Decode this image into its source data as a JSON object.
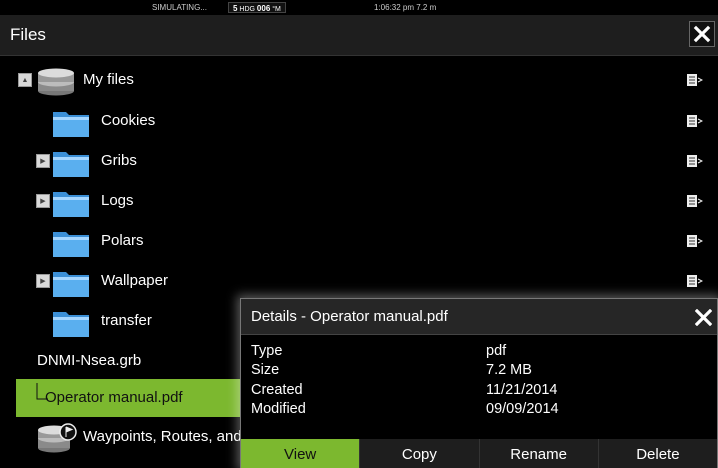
{
  "status": {
    "simulating": "SIMULATING...",
    "heading_value": "5",
    "heading_prefix": "HDG",
    "heading_degrees": "006",
    "heading_unit": "°M",
    "time_depth": "1:06:32 pm  7.2 m"
  },
  "window": {
    "title": "Files"
  },
  "tree": {
    "items": [
      {
        "label": "My files",
        "icon": "storage-drive-icon",
        "expander": "collapse"
      },
      {
        "label": "Cookies",
        "icon": "folder-icon",
        "expander": ""
      },
      {
        "label": "Gribs",
        "icon": "folder-icon",
        "expander": "expand"
      },
      {
        "label": "Logs",
        "icon": "folder-icon",
        "expander": "expand"
      },
      {
        "label": "Polars",
        "icon": "folder-icon",
        "expander": ""
      },
      {
        "label": "Wallpaper",
        "icon": "folder-icon",
        "expander": "expand"
      },
      {
        "label": "transfer",
        "icon": "folder-icon",
        "expander": ""
      },
      {
        "label": "DNMI-Nsea.grb",
        "icon": "",
        "expander": ""
      },
      {
        "label": "Operator manual.pdf",
        "icon": "",
        "expander": "",
        "selected": true
      },
      {
        "label": "Waypoints, Routes, and T",
        "icon": "waypoint-database-icon",
        "expander": ""
      }
    ]
  },
  "details": {
    "title": "Details - Operator manual.pdf",
    "fields": [
      {
        "key": "Type",
        "value": "pdf"
      },
      {
        "key": "Size",
        "value": "7.2 MB"
      },
      {
        "key": "Created",
        "value": "11/21/2014"
      },
      {
        "key": "Modified",
        "value": "09/09/2014"
      }
    ],
    "actions": [
      "View",
      "Copy",
      "Rename",
      "Delete"
    ]
  },
  "colors": {
    "accent": "#7cb82f",
    "background": "#000000",
    "panel": "#1e1e1e"
  }
}
